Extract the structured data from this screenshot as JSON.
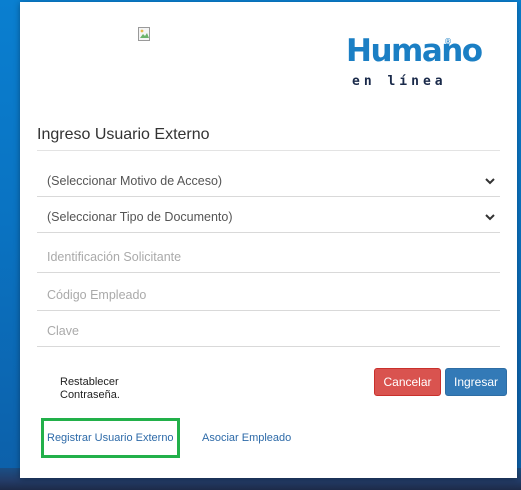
{
  "logo": {
    "brand": "Humano",
    "registered": "®",
    "subtitle": "en línea",
    "brand_color": "#1b7fc4"
  },
  "broken_image_icon": "broken-image-icon",
  "form": {
    "title": "Ingreso Usuario Externo",
    "access_reason_select": "(Seleccionar Motivo de Acceso)",
    "document_type_select": "(Seleccionar Tipo de Documento)",
    "applicant_id_placeholder": "Identificación Solicitante",
    "employee_code_placeholder": "Código Empleado",
    "password_placeholder": "Clave",
    "restore_password": "Restablecer Contraseña.",
    "cancel_label": "Cancelar",
    "enter_label": "Ingresar",
    "register_link": "Registrar Usuario Externo",
    "associate_link": "Asociar Empleado"
  },
  "colors": {
    "cancel": "#d9534f",
    "enter": "#337ab7",
    "highlight": "#22b04a",
    "link": "#2d6aa8"
  }
}
